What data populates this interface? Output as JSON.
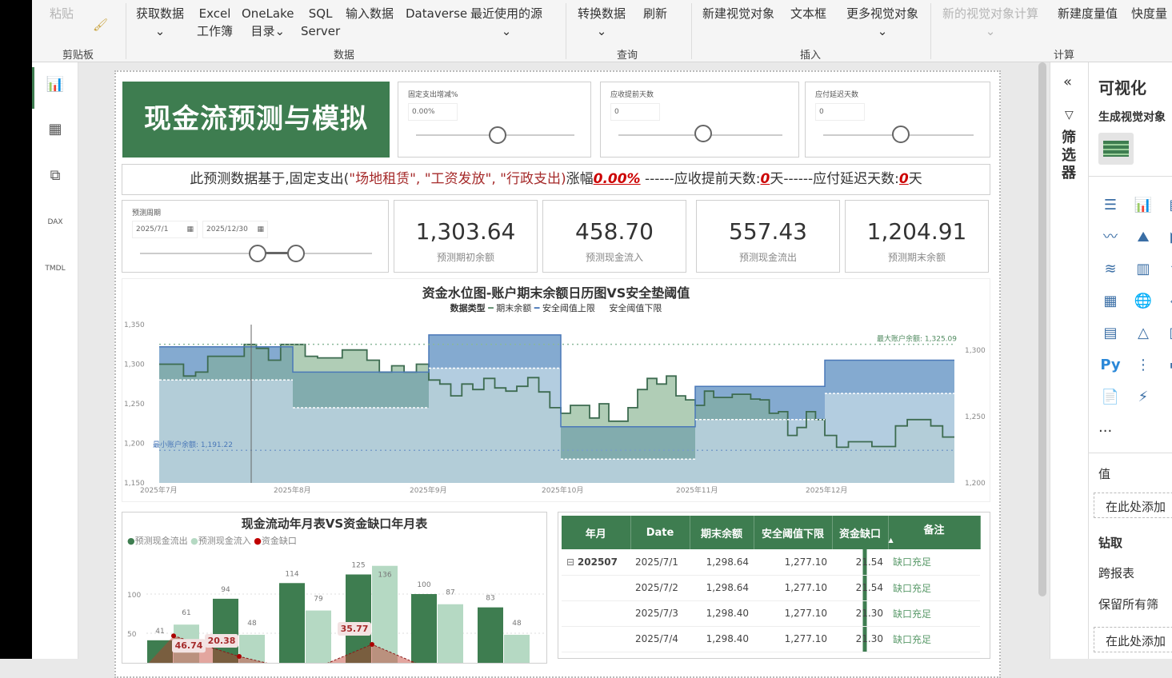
{
  "ribbon": {
    "clipboard": {
      "paste": "粘贴",
      "group": "剪贴板"
    },
    "data": {
      "get_data": "获取数据",
      "excel": "Excel",
      "excel2": "工作簿",
      "onelake": "OneLake",
      "onelake2": "目录",
      "sql": "SQL",
      "sql2": "Server",
      "enter": "输入数据",
      "dataverse": "Dataverse",
      "recent": "最近使用的源",
      "group": "数据"
    },
    "query": {
      "transform": "转换数据",
      "refresh": "刷新",
      "group": "查询"
    },
    "insert": {
      "new_visual": "新建视觉对象",
      "textbox": "文本框",
      "more": "更多视觉对象",
      "group": "插入"
    },
    "calc": {
      "visual_calc": "新的视觉对象计算",
      "new_measure": "新建度量值",
      "quick": "快度量",
      "group": "计算"
    }
  },
  "report": {
    "title": "现金流预测与模拟",
    "slicers": [
      {
        "label": "固定支出增减%",
        "value": "0.00%",
        "position": 0.5
      },
      {
        "label": "应收提前天数",
        "value": "0",
        "position": 0.5
      },
      {
        "label": "应付延迟天数",
        "value": "0",
        "position": 0.5
      }
    ],
    "banner": {
      "p1": "此预测数据基于,固定支出(",
      "items": "\"场地租赁\", \"工资发放\", \"行政支出)",
      "p2": "涨幅",
      "pct": "0.00%",
      "p3": " ------应收提前天数:",
      "ar": "0",
      "p4": "天------应付延迟天数:",
      "ap": "0",
      "p5": "天"
    },
    "date_slicer": {
      "label": "预测周期",
      "start": "2025/7/1",
      "end": "2025/12/30"
    },
    "kpis": [
      {
        "value": "1,303.64",
        "label": "预测期初余额"
      },
      {
        "value": "458.70",
        "label": "预测现金流入"
      },
      {
        "value": "557.43",
        "label": "预测现金流出"
      },
      {
        "value": "1,204.91",
        "label": "预测期末余额"
      }
    ]
  },
  "chart_data": [
    {
      "type": "area",
      "title": "资金水位图-账户期末余额日历图VS安全垫阈值",
      "legend_title": "数据类型",
      "legend": [
        "期末余额",
        "安全阈值上限",
        "安全阈值下限"
      ],
      "x_ticks": [
        "2025年7月",
        "2025年8月",
        "2025年9月",
        "2025年10月",
        "2025年11月",
        "2025年12月"
      ],
      "ylim": [
        1150,
        1350
      ],
      "y_ticks": [
        1150,
        1200,
        1250,
        1300,
        1350
      ],
      "y2_ticks": [
        1200,
        1250,
        1300
      ],
      "max_label": "最大账户余额: 1,325.09",
      "max_value": 1325.09,
      "min_label": "最小账户余额: 1,191.22",
      "min_value": 1191.22,
      "balance": [
        [
          1300,
          1300,
          1285,
          1290,
          1310,
          1310,
          1310,
          1325,
          1320,
          1305,
          1325
        ],
        [
          1325,
          1310,
          1308,
          1308,
          1318,
          1318,
          1305,
          1290,
          1298,
          1290,
          1300
        ],
        [
          1280,
          1275,
          1260,
          1275,
          1268,
          1282,
          1270,
          1266,
          1272,
          1283,
          1265,
          1245
        ],
        [
          1238,
          1248,
          1248,
          1232,
          1250,
          1228,
          1228,
          1245,
          1268,
          1282,
          1275,
          1285,
          1260,
          1255
        ],
        [
          1248,
          1266,
          1258,
          1258,
          1262,
          1262,
          1256,
          1255,
          1238,
          1240,
          1210,
          1220,
          1240,
          1230
        ],
        [
          1210,
          1195,
          1202,
          1202,
          1196,
          1196,
          1222,
          1230,
          1230,
          1222,
          1208
        ]
      ],
      "upper": [
        1322,
        1290,
        1337,
        1221,
        1272,
        1305
      ],
      "lower": [
        1280,
        1245,
        1295,
        1180,
        1230,
        1263
      ]
    },
    {
      "type": "bar",
      "title": "现金流动年月表VS资金缺口年月表",
      "legend": [
        "预测现金流出",
        "预测现金流入",
        "资金缺口"
      ],
      "series": [
        {
          "name": "预测现金流出",
          "values": [
            41,
            94,
            114,
            125,
            100,
            83
          ]
        },
        {
          "name": "预测现金流入",
          "values": [
            61,
            48,
            79,
            136,
            87,
            48
          ]
        },
        {
          "name": "资金缺口",
          "values": [
            46.74,
            20.38,
            null,
            35.77,
            null,
            null
          ]
        }
      ],
      "y_ticks": [
        50,
        100
      ]
    }
  ],
  "table": {
    "headers": [
      "年月",
      "Date",
      "期末余额",
      "安全阈值下限",
      "资金缺口",
      "备注"
    ],
    "group": "202507",
    "rows": [
      [
        "2025/7/1",
        "1,298.64",
        "1,277.10",
        "21.54",
        "缺口充足"
      ],
      [
        "2025/7/2",
        "1,298.64",
        "1,277.10",
        "21.54",
        "缺口充足"
      ],
      [
        "2025/7/3",
        "1,298.40",
        "1,277.10",
        "21.30",
        "缺口充足"
      ],
      [
        "2025/7/4",
        "1,298.40",
        "1,277.10",
        "21.30",
        "缺口充足"
      ]
    ]
  },
  "panes": {
    "filters": "筛选器",
    "viz_title": "可视化",
    "build": "生成视觉对象",
    "more": "...",
    "values": "值",
    "add_here": "在此处添加",
    "drill": "钻取",
    "cross": "跨报表",
    "keep": "保留所有筛",
    "add_here2": "在此处添加"
  },
  "colors": {
    "green": "#3e7d50",
    "light_green": "#b5d9c3",
    "red": "#c00000",
    "blue": "#5b8cc8"
  }
}
